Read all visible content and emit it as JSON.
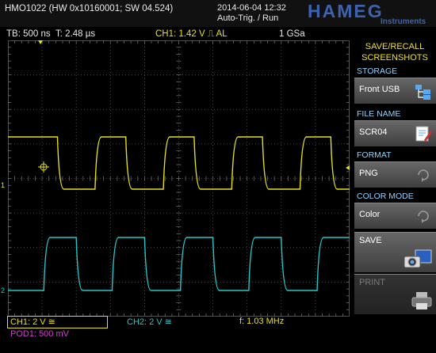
{
  "header": {
    "model": "HMO1022 (HW 0x10160001; SW 04.524)",
    "datetime": "2014-06-04 12:32",
    "trigger_mode": "Auto-Trig. / Run",
    "logo": "HAMEG",
    "logo_sub": "Instruments"
  },
  "infobar": {
    "timebase": "TB: 500 ns",
    "trigger_time": "T: 2.48 µs",
    "trigger": "CH1: 1.42 V ⎍ AL",
    "sample_rate": "1 GSa"
  },
  "menu": {
    "title_line1": "SAVE/RECALL",
    "title_line2": "SCREENSHOTS",
    "storage_label": "STORAGE",
    "storage_value": "Front USB",
    "filename_label": "FILE NAME",
    "filename_value": "SCR04",
    "format_label": "FORMAT",
    "format_value": "PNG",
    "colormode_label": "COLOR MODE",
    "colormode_value": "Color",
    "save_label": "SAVE",
    "print_label": "PRINT"
  },
  "status": {
    "ch1": "CH1: 2 V ≅",
    "ch2": "CH2: 2 V ≅",
    "freq": "f: 1.03 MHz",
    "pod1": "POD1: 500 mV"
  },
  "colors": {
    "ch1": "#e6e01e",
    "ch2": "#27c6c9",
    "pod": "#d040d0",
    "menu_section": "#8fd2ff",
    "logo": "#3d63b0"
  },
  "waveforms": {
    "ch1_rising_edges_div": [
      0.45,
      2.55,
      4.55,
      6.55,
      8.55
    ],
    "ch1_falling_edges_div": [
      0.0,
      1.45,
      3.45,
      5.45,
      7.45,
      9.45
    ],
    "ch2_rising_edges_div": [
      1.05,
      3.05,
      5.05,
      7.05,
      9.05
    ],
    "ch2_falling_edges_div": [
      2.0,
      4.0,
      6.0,
      8.0
    ]
  }
}
